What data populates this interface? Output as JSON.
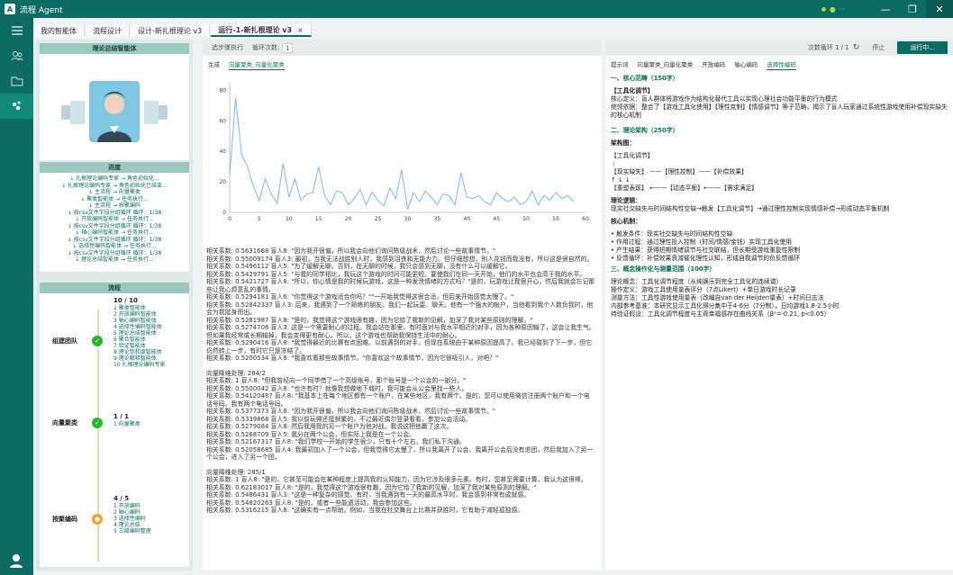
{
  "window": {
    "logo": "A",
    "title": "流程 Agent",
    "status": "● ···"
  },
  "tabs": [
    {
      "label": "我的智能体",
      "active": false
    },
    {
      "label": "流程设计",
      "active": false
    },
    {
      "label": "设计-新扎根理论 v3",
      "active": false
    },
    {
      "label": "运行-1-新扎根理论 v3",
      "active": true,
      "close": "×"
    }
  ],
  "sidebar": {
    "agent_title": "理论总结智能体",
    "progress_title": "进度",
    "progress_items": [
      "↓ 扎根理论编码专家 → 角色初始化...",
      "↓ 扎根理论编码专家 → 角色初始化已结束...",
      "↓ 主流程 → 向量聚类",
      "↓ 聚类智能体 → 任务执行...",
      "↓ 主流程 → 按聚编码",
      "↓ 按csv文件字段分组循环 循环：1/38",
      "↓ 开放编码智能体 → 任务执行...",
      "↓ 按csv文件字段分组循环 循环：1/38",
      "↓ 轴心编码智能体 → 任务执行...",
      "↓ 按csv文件字段分组循环 循环：1/38",
      "↓ 选择性编码智能体 → 任务执行...",
      "↓ 按csv文件字段分组循环 循环：1/38",
      "↓ 理论总结智能体 → 任务执行..."
    ],
    "flow_title": "流程",
    "flow": [
      {
        "name": "组建团队",
        "count": "10 / 10",
        "status": "done",
        "items": [
          "1 聚类智能体",
          "2 开放编码智能体",
          "3 轴心编码智能体",
          "4 选择性编码智能体",
          "5 理论总结智能体",
          "6 聚合智能体",
          "7 验证智能体",
          "8 理论饱和度智能体",
          "9 理论解释智能体",
          "10 扎根理论编码专家"
        ]
      },
      {
        "name": "向量聚类",
        "count": "1 / 1",
        "status": "done",
        "items": [
          "1 向量聚类"
        ]
      },
      {
        "name": "按聚编码",
        "count": "4 / 5",
        "status": "running",
        "items": [
          "1 开放编码",
          "2 轴心编码",
          "3 选择性编码",
          "4 理论总结",
          "5 三级编码整理"
        ]
      }
    ]
  },
  "middle": {
    "toolbar": {
      "label1": "选步骤执行",
      "label2": "循环次数:",
      "loop_value": "1"
    },
    "subtabs": [
      "生成",
      "向量聚类_向量化聚类"
    ],
    "log": [
      "相关系数: 0.5631668 盲人8: \"因为我开很偏，所以我会向他们询问陈级战术，然后讨论一些故事情节。\"",
      "相关系数: 0.55009174 盲人3: 最初，当我无法战胜别人时，我感到沮丧和无能为力。但仔细想想，别人花钱而我没有，所以这是很自然的。",
      "相关系数: 0.5496112 盲人5: \"为了缓解无聊。否则，在无聊的时候，我只会感到无聊，没有什么可以缓解它。",
      "相关系数: 0.5429791 盲人5: \"与我的同学相比，我玩这个游戏的时间可能更短。要使我们在同一天开始，他们的水平也会高于我的水平。",
      "相关系数: 0.5421727 盲人8: \"所以，你心情是我的时候玩游戏，这是一种发泄情绪的方式吗？\"是的，玩游戏让我很开心，然后我就会忘记那些让我心烦意乱的事情。",
      "相关系数: 0.5294181 盲人6: \"你觉得这个游戏适合你吗？\"\"一开始我觉得这很合适，但后来开始感觉太慢了。\"",
      "相关系数: 0.52842337 盲人3: 后来，我遇到了一个熟练的朋友。我们一起玩耍、聊天。他有一个强大的帐户，当他看到我个人数负我时，他会为我挺身而出。",
      "相关系数: 0.5281987 盲人8: \"是的，我觉得这个游戏很有趣，因为它给了我新的见解，加深了我对某些原则的理解。\"",
      "相关系数: 0.5274706 盲人3: 这是一个需要耐心的过程。我会站在那里，有时面对与我水平相近的对手，因为各种原因输了，这会让我生气。但如果我经常或长期输掉，我会变得更有耐心。所以，这个游戏也帮助我保持生活中的耐心。",
      "相关系数: 0.5290416 盲人8: \"我觉得最近的比赛有点困难。以前遇到的对手，但现在系统由于某种原因提高了。我已经碰到了下一步，但它仍然转上一步，有时它只是冻结了。",
      "相关系数: 0.5200534 盲人8: \"我喜欢看那些故事情节。\"你喜欢这个故事情节，因为它很吸引人，对吧？\"",
      "",
      "向量降维处理: 284/2",
      "相关系数: 1 盲人8: \"但我曾经向一个同学借了一个高级账号，那个账号是一个公会的一部分。\"",
      "相关系数: 0.5500042 盲人8: \"也许有时？就像我想做地下城时，我可能会从公会里找一些人。",
      "相关系数: 0.54120487 盲人8: \"我基本上在每个地区都有一个账户，在某些地区，我有两个。是的，您可以使用微信注册两个账户和一个电话号码。我有两个电话号码。",
      "相关系数: 0.5377373 盲人8: \"因为我开很偏，所以我会向他们询问陈级战术，然后讨论一些故事情节。\"",
      "相关系数: 0.5339868 盲人5: 我以前玩得还挺频繁的，不过最近偶尔登录看看，参加公会活动。",
      "相关系数: 0.5279084 盲人8: 然后我用我的另一个账户为他对战。我说这把他赢了这次。",
      "相关系数: 0.5268709 盲人5: 我分在两个公会，但实际上我是在一个公会。",
      "相关系数: 0.52167317 盲人8: \"我们学校一开始的学生很少，只有十个左右。我们私下沟通。",
      "相关系数: 0.52058685 盲人4: 我最初加入了一个公会，但我觉得它太慢了，所以我离开了公会。我离开公会后没有退团，然后我加入了另一个公会，进入了另一个团。",
      "",
      "向量降维处理: 285/1",
      "相关系数: 1 盲人8: \"是的，它甚至可能会在某种程度上提高我的认知能力，因为它涉及很多元素。有时，您甚至需要计算，我认为这很棒。",
      "相关系数: 0.62183017 盲人8: \"是的，我觉得这个游戏很有趣，因为它给了我新的见解，加深了我对某些原则的理解。\"",
      "相关系数: 0.5486431 盲人3: \"这是一种复杂的感觉。有时，当我遇到有一天的最高水平时，我会感到非常有成就感。",
      "相关系数: 0.54820263 盲人8: \"是的，或者一些能遗活动，我会参加这些。",
      "相关系数: 0.5316215 盲人8: \"这确实有一点帮助。例如，当我在社交舞台上比赛并获胜时，它有助于减轻孤独感。"
    ]
  },
  "chart_data": {
    "type": "line",
    "title": "",
    "xlabel": "",
    "ylabel": "",
    "xlim": [
      0,
      60
    ],
    "ylim": [
      0,
      85
    ],
    "xticks": [
      0,
      5,
      10,
      15,
      20,
      25,
      30,
      35,
      40,
      45,
      50,
      55,
      60
    ],
    "yticks": [
      0,
      20,
      40,
      60,
      80
    ],
    "x": [
      0,
      1,
      2,
      3,
      4,
      5,
      6,
      7,
      8,
      9,
      10,
      11,
      12,
      13,
      14,
      15,
      16,
      17,
      18,
      19,
      20,
      21,
      22,
      23,
      24,
      25,
      26,
      27,
      28,
      29,
      30,
      31,
      32,
      33,
      34,
      35,
      36,
      37,
      38,
      39,
      40,
      41,
      42,
      43,
      44,
      45,
      46,
      47,
      48,
      49,
      50,
      51,
      52,
      53,
      54,
      55,
      56,
      57,
      58
    ],
    "series": [
      {
        "values": [
          25,
          75,
          38,
          30,
          17,
          8,
          22,
          12,
          6,
          32,
          10,
          22,
          8,
          12,
          13,
          30,
          11,
          5,
          14,
          13,
          5,
          9,
          15,
          5,
          13,
          8,
          4,
          16,
          9,
          28,
          2,
          13,
          7,
          14,
          10,
          5,
          12,
          11,
          5,
          26,
          10,
          9,
          11,
          7,
          5,
          13,
          9,
          7,
          10,
          5,
          7,
          14,
          5,
          11,
          8,
          13,
          9,
          11,
          7
        ]
      }
    ]
  },
  "right": {
    "toolbar": {
      "counter": "次数循环 1 / 1",
      "stop": "停止",
      "run": "运行中..."
    },
    "subtabs": [
      "提示词",
      "向量聚类_向量化聚类",
      "开放编码",
      "轴心编码",
      "选择性编码"
    ],
    "doc": [
      {
        "style": "h",
        "text": "一、核心范畴（150字）"
      },
      {
        "style": "",
        "text": ""
      },
      {
        "style": "b",
        "text": "【工具化调节】"
      },
      {
        "style": "",
        "text": "核心定义：盲人群体将游戏作为结构化替代工具以实现心理社会功能平衡的行为模式"
      },
      {
        "style": "",
        "text": "统领依据：整合了【游戏工具化使用】【理性克制】【情感调节】等子范畴，揭示了盲人玩家通过系统性游戏使用补偿现实缺失的核心机制"
      },
      {
        "style": "",
        "text": ""
      },
      {
        "style": "h",
        "text": "二、理论架构（250字）"
      },
      {
        "style": "",
        "text": ""
      },
      {
        "style": "b",
        "text": "架构图："
      },
      {
        "style": "",
        "text": ""
      },
      {
        "style": "",
        "text": "【工具化调节】"
      },
      {
        "style": "",
        "text": "   ｜"
      },
      {
        "style": "",
        "text": "【现实缺失】 ——【理性控制】——【补偿效果】"
      },
      {
        "style": "",
        "text": "   ↑          ↓          ↓"
      },
      {
        "style": "",
        "text": "【重塑表现】 ←——【动态平衡】←——【需求满足】"
      },
      {
        "style": "",
        "text": ""
      },
      {
        "style": "b",
        "text": "理论逻辑："
      },
      {
        "style": "",
        "text": "现实社交缺失与时间结构性空缺→触发【工具化调节】→通过理性控制实现情感补偿→形成动态平衡机制"
      },
      {
        "style": "",
        "text": ""
      },
      {
        "style": "b",
        "text": "核心机制："
      },
      {
        "style": "",
        "text": ""
      },
      {
        "style": "",
        "text": "        • 触发条件：现实社交缺失与时间结构性空缺"
      },
      {
        "style": "",
        "text": "        • 作用过程：通过理性投入控制（时间/情感/金钱）实现工具化使用"
      },
      {
        "style": "",
        "text": "        • 产生结果：获得短期情绪调节与社交联结，但长期受游戏重复性限制"
      },
      {
        "style": "",
        "text": "        • 反馈循环：补偿效果衰减催化理性认知，形成自我调节的负反馈循环"
      },
      {
        "style": "h",
        "text": "三、概念操作化与测量范围（100字）"
      },
      {
        "style": "",
        "text": ""
      },
      {
        "style": "",
        "text": "理论概念：工具化调节程度（从纯娱乐到完全工具化的连续谱）"
      },
      {
        "style": "",
        "text": "操作定义：游戏工具使用量表评分（7点Likert）+单日游戏时长记录"
      },
      {
        "style": "",
        "text": "测量方法：工具性游戏使用量表（改编自van der Heijden量表）+时间日志法"
      },
      {
        "style": "",
        "text": "内部参考基准：本研究显示工具化得分集中于4-6分（7分制），日均游戏1.8-2.5小时"
      },
      {
        "style": "",
        "text": "待验证假设：工具化调节程度与主观幸福感存在曲线关系（β²=-0.21, p<0.05）"
      }
    ]
  },
  "colors": {
    "brand": "#0c6b62",
    "accent": "#9bc9c2",
    "line": "#7db6ea",
    "done": "#2bb52a",
    "running": "#f0a030"
  }
}
